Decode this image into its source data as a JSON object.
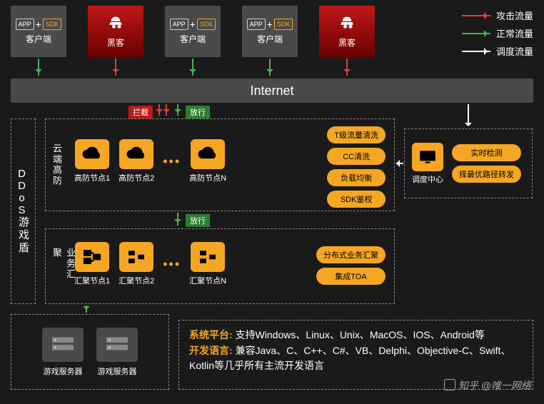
{
  "legend": {
    "attack": "攻击流量",
    "normal": "正常流量",
    "dispatch": "调度流量"
  },
  "top": {
    "client": "客户端",
    "hacker": "黑客",
    "app": "APP",
    "sdk": "SDK"
  },
  "internet": "Internet",
  "tags": {
    "block": "拦截",
    "pass": "放行"
  },
  "shield_title": "DDoS游戏盾",
  "cloud": {
    "label": "云端高防",
    "nodes": [
      "高防节点1",
      "高防节点2",
      "高防节点N"
    ],
    "pills": [
      "T级流量清洗",
      "CC清洗",
      "负载均衡",
      "SDK鉴权"
    ]
  },
  "biz": {
    "label": "业务汇聚",
    "nodes": [
      "汇聚节点1",
      "汇聚节点2",
      "汇聚节点N"
    ],
    "pills": [
      "分布式业务汇聚",
      "集成TOA"
    ]
  },
  "sched": {
    "label": "调度中心",
    "pills": [
      "实时检测",
      "择最优路径转发"
    ]
  },
  "servers": {
    "label": "游戏服务器"
  },
  "compat": {
    "platform_label": "系统平台:",
    "platform_text": "支持Windows、Linux、Unix、MacOS、IOS、Android等",
    "lang_label": "开发语言:",
    "lang_text": "兼容Java、C、C++、C#、VB、Delphi、Objective-C、Swift、Kotlin等几乎所有主流开发语言"
  },
  "watermark": "知乎 @唯一网络"
}
